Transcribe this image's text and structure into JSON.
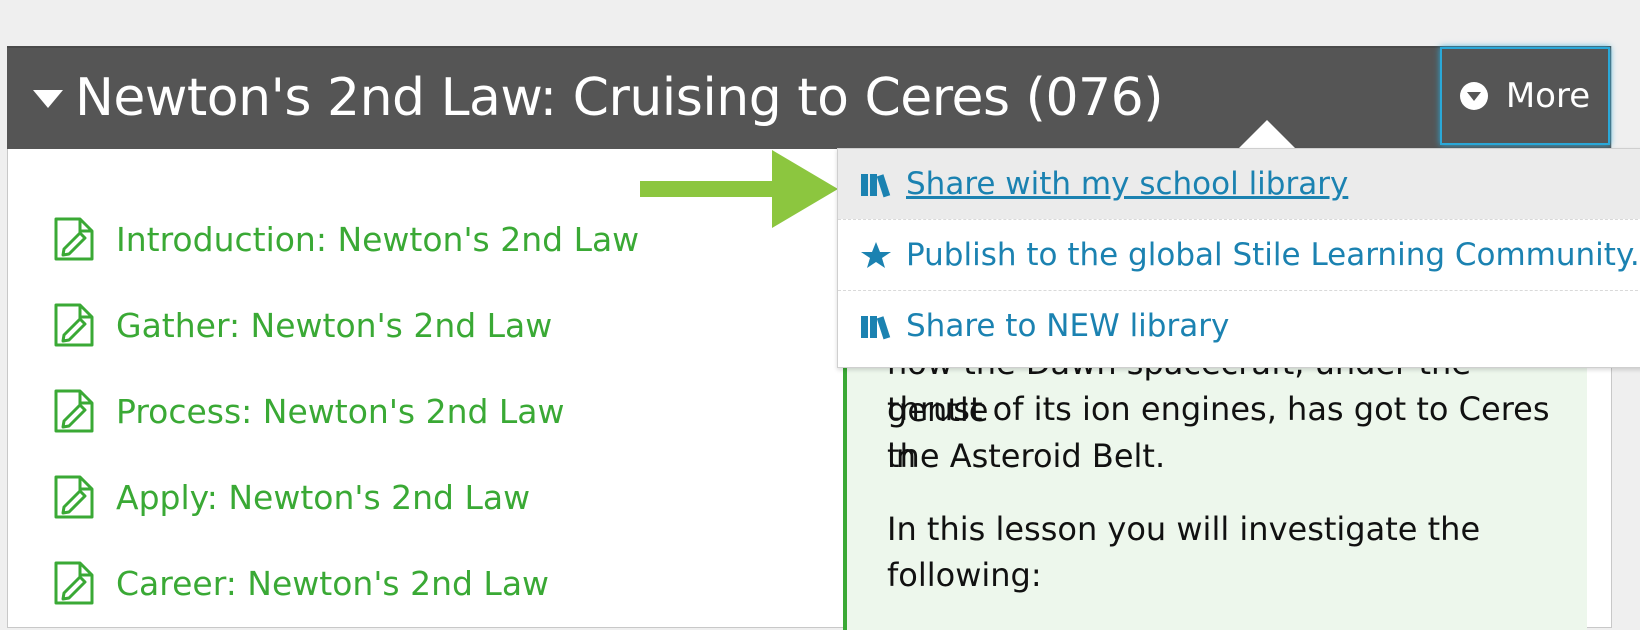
{
  "header": {
    "title": "Newton's 2nd Law: Cruising to Ceres (076)",
    "more_label": "More"
  },
  "lessons": [
    {
      "label": "Introduction: Newton's 2nd Law"
    },
    {
      "label": "Gather: Newton's 2nd Law"
    },
    {
      "label": "Process: Newton's 2nd Law"
    },
    {
      "label": "Apply: Newton's 2nd Law"
    },
    {
      "label": "Career: Newton's 2nd Law"
    }
  ],
  "description": {
    "partial_line": "how the Dawn spacecraft, under the gentle",
    "line2": "thrust of its ion engines, has got to Ceres in",
    "line3": "the Asteroid Belt.",
    "line4": "In this lesson you will investigate the",
    "line5": "following:"
  },
  "dropdown": {
    "items": [
      {
        "label": "Share with my school library",
        "icon": "library-icon"
      },
      {
        "label": "Publish to the global Stile Learning Community...",
        "icon": "star-icon"
      },
      {
        "label": "Share to NEW library",
        "icon": "library-icon"
      }
    ]
  },
  "colors": {
    "header_bg": "#555555",
    "accent_green": "#3aa935",
    "link_blue": "#1b82b1",
    "focus_blue": "#2aa8d8",
    "arrow_green": "#8cc63f"
  }
}
